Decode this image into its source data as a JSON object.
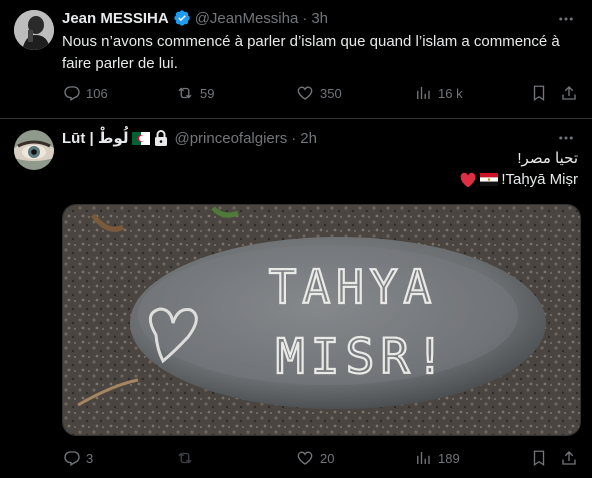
{
  "tweets": [
    {
      "name": "Jean MESSIHA",
      "handle": "@JeanMessiha",
      "dot": "·",
      "time": "3h",
      "text": "Nous n’avons commencé à parler d’islam que quand l’islam a commencé à faire parler de lui.",
      "replies": "106",
      "retweets": "59",
      "likes": "350",
      "views": "16 k"
    },
    {
      "name": "Lūt | لُوطْ",
      "handle": "@princeofalgiers",
      "dot": "·",
      "time": "2h",
      "text_line1": "تحيا مصر!",
      "text_line2": "!Taḥyā Miṣr",
      "image_text": "TAHYA MISR!",
      "replies": "3",
      "retweets": "",
      "likes": "20",
      "views": "189"
    }
  ],
  "colors": {
    "muted": "#71767b",
    "text": "#e7e9ea",
    "verified": "#1d9bf0",
    "heart": "#f91880"
  },
  "icons": [
    "more-icon",
    "reply-icon",
    "retweet-icon",
    "like-icon",
    "views-icon",
    "bookmark-icon",
    "share-icon",
    "verified-icon",
    "lock-icon",
    "algeria-flag-icon",
    "egypt-flag-icon",
    "red-heart-icon"
  ]
}
